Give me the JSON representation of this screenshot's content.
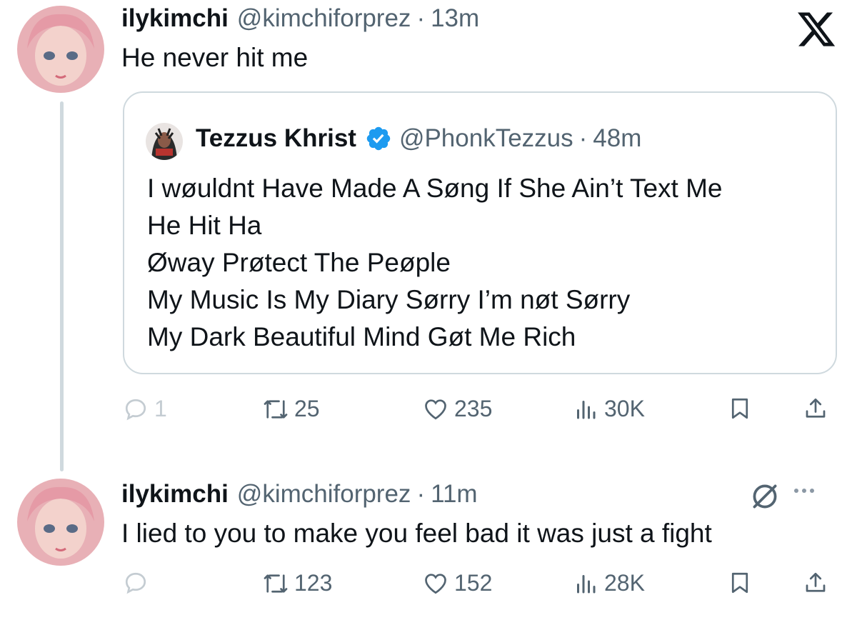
{
  "platform": {
    "logo_icon": "x-logo-icon"
  },
  "posts": [
    {
      "display_name": "ilykimchi",
      "handle": "@kimchiforprez",
      "separator": "·",
      "time": "13m",
      "text": "He never hit me",
      "quoted_post": {
        "display_name": "Tezzus Khrist",
        "verified": true,
        "handle": "@PhonkTezzus",
        "separator": "·",
        "time": "48m",
        "lines": [
          "I wøuldnt Have Made A Søng If She Ain’t Text Me",
          "He Hit Ha",
          "Øway Prøtect The Peøple",
          "My Music Is My Diary Sørry I’m nøt Sørry",
          "My Dark Beautiful Mind Gøt Me Rich"
        ]
      },
      "stats": {
        "replies": "1",
        "reposts": "25",
        "likes": "235",
        "views": "30K"
      }
    },
    {
      "display_name": "ilykimchi",
      "handle": "@kimchiforprez",
      "separator": "·",
      "time": "11m",
      "text": "I lied to you to make you feel bad it was just a fight",
      "stats": {
        "replies": "",
        "reposts": "123",
        "likes": "152",
        "views": "28K"
      }
    }
  ],
  "colors": {
    "text": "#0f1419",
    "secondary": "#536471",
    "border": "#cfd9de",
    "verified": "#1d9bf0"
  }
}
